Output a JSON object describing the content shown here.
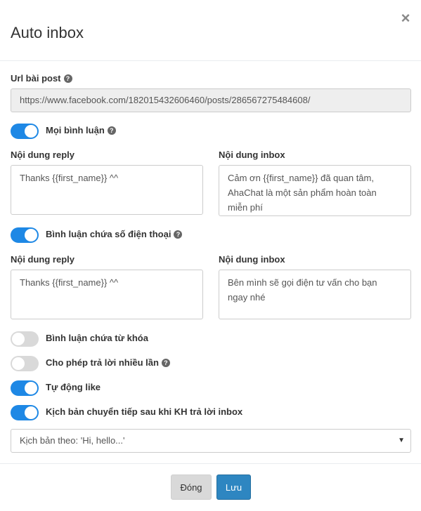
{
  "header": {
    "title": "Auto inbox",
    "close_symbol": "×"
  },
  "url_section": {
    "label": "Url bài post",
    "value": "https://www.facebook.com/182015432606460/posts/286567275484608/"
  },
  "rules": [
    {
      "label": "Mọi bình luận",
      "enabled": true,
      "has_help": true,
      "reply_label": "Nội dung reply",
      "reply_text": "Thanks {{first_name}} ^^",
      "inbox_label": "Nội dung inbox",
      "inbox_lines": [
        "Cảm ơn {{first_name}} đã quan tâm,",
        "AhaChat là một sản phẩm hoàn toàn",
        "miễn phí"
      ]
    },
    {
      "label": "Bình luận chứa số điện thoại",
      "enabled": true,
      "has_help": true,
      "reply_label": "Nội dung reply",
      "reply_text": "Thanks {{first_name}} ^^",
      "inbox_label": "Nội dung inbox",
      "inbox_lines": [
        "Bên mình sẽ gọi điện tư vấn cho bạn",
        "ngay nhé"
      ]
    }
  ],
  "options": [
    {
      "label": "Bình luận chứa từ khóa",
      "enabled": false
    },
    {
      "label": "Cho phép trả lời nhiều lần",
      "enabled": false,
      "has_help": true
    },
    {
      "label": "Tự động like",
      "enabled": true
    },
    {
      "label": "Kịch bản chuyển tiếp sau khi KH trả lời inbox",
      "enabled": true
    }
  ],
  "scenario_select": {
    "value": "Kịch bản theo: 'Hi, hello...'"
  },
  "footer": {
    "close_label": "Đóng",
    "save_label": "Lưu"
  },
  "help_symbol": "?",
  "colors": {
    "toggle_on": "#1e88e5",
    "toggle_off": "#d9d9d9",
    "save_button": "#2e86c1",
    "url_input_bg": "#eeeeee"
  }
}
